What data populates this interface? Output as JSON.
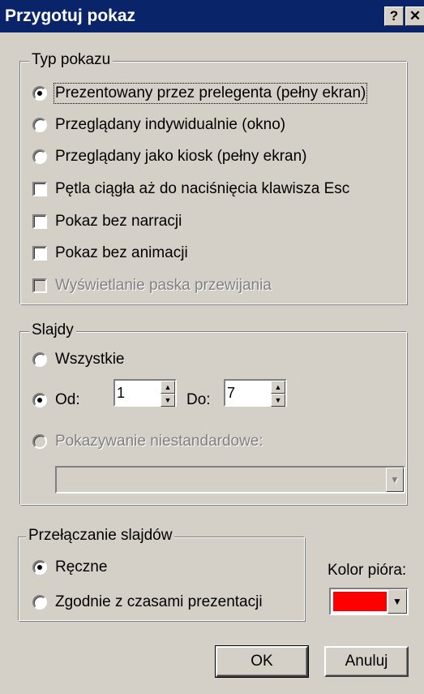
{
  "window": {
    "title": "Przygotuj pokaz",
    "help_label": "?",
    "close_label": "✕"
  },
  "show_type": {
    "legend": "Typ pokazu",
    "options": [
      {
        "label": "Prezentowany przez prelegenta (pełny ekran)",
        "checked": true
      },
      {
        "label": "Przeglądany indywidualnie (okno)",
        "checked": false
      },
      {
        "label": "Przeglądany jako kiosk (pełny ekran)",
        "checked": false
      }
    ],
    "checkboxes": [
      {
        "label": "Pętla ciągła aż do naciśnięcia klawisza Esc",
        "checked": false,
        "enabled": true
      },
      {
        "label": "Pokaz bez narracji",
        "checked": false,
        "enabled": true
      },
      {
        "label": "Pokaz bez animacji",
        "checked": false,
        "enabled": true
      },
      {
        "label": "Wyświetlanie paska przewijania",
        "checked": false,
        "enabled": false
      }
    ]
  },
  "slides": {
    "legend": "Slajdy",
    "all_label": "Wszystkie",
    "from_label": "Od:",
    "from_value": "1",
    "to_label": "Do:",
    "to_value": "7",
    "custom_label": "Pokazywanie niestandardowe:",
    "custom_value": ""
  },
  "advance": {
    "legend": "Przełączanie slajdów",
    "manual_label": "Ręczne",
    "timings_label": "Zgodnie z czasami prezentacji"
  },
  "pen": {
    "label": "Kolor pióra:",
    "color": "#ff0000"
  },
  "buttons": {
    "ok_label": "OK",
    "cancel_label": "Anuluj"
  },
  "icons": {
    "spin_up": "▲",
    "spin_down": "▼",
    "dropdown": "▼"
  }
}
